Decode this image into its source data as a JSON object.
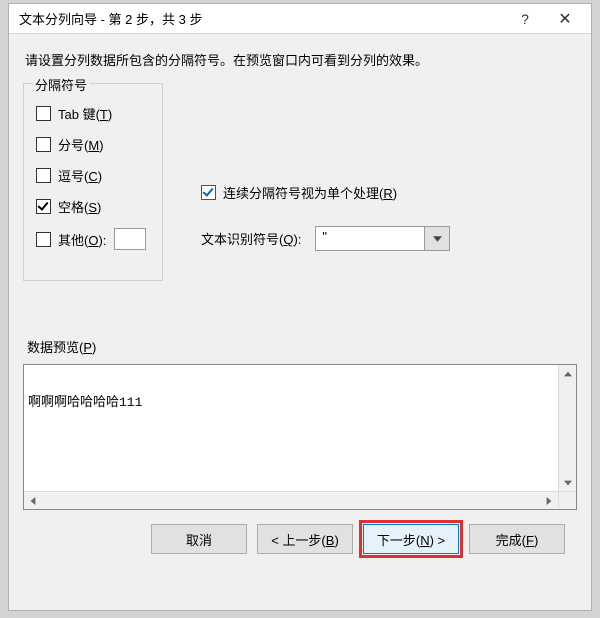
{
  "titlebar": {
    "title": "文本分列向导 - 第 2 步，共 3 步",
    "help_label": "?",
    "close_label": "✕"
  },
  "instruction": "请设置分列数据所包含的分隔符号。在预览窗口内可看到分列的效果。",
  "delimiters": {
    "legend": "分隔符号",
    "tab": {
      "label_prefix": "Tab 键(",
      "hotkey": "T",
      "label_suffix": ")",
      "checked": false
    },
    "semi": {
      "label_prefix": "分号(",
      "hotkey": "M",
      "label_suffix": ")",
      "checked": false
    },
    "comma": {
      "label_prefix": "逗号(",
      "hotkey": "C",
      "label_suffix": ")",
      "checked": false
    },
    "space": {
      "label_prefix": "空格(",
      "hotkey": "S",
      "label_suffix": ")",
      "checked": true
    },
    "other": {
      "label_prefix": "其他(",
      "hotkey": "O",
      "label_suffix": "):",
      "checked": false,
      "value": ""
    }
  },
  "consecutive": {
    "label_prefix": "连续分隔符号视为单个处理(",
    "hotkey": "R",
    "label_suffix": ")",
    "checked": true
  },
  "text_qualifier": {
    "label_prefix": "文本识别符号(",
    "hotkey": "Q",
    "label_suffix": "):",
    "value": "\""
  },
  "preview": {
    "label_prefix": "数据预览(",
    "hotkey": "P",
    "label_suffix": ")",
    "rows": [
      "啊啊啊哈哈哈哈111"
    ]
  },
  "buttons": {
    "cancel": "取消",
    "back": {
      "prefix": "< 上一步(",
      "hotkey": "B",
      "suffix": ")"
    },
    "next": {
      "prefix": "下一步(",
      "hotkey": "N",
      "suffix": ") >"
    },
    "finish": {
      "prefix": "完成(",
      "hotkey": "F",
      "suffix": ")"
    }
  }
}
